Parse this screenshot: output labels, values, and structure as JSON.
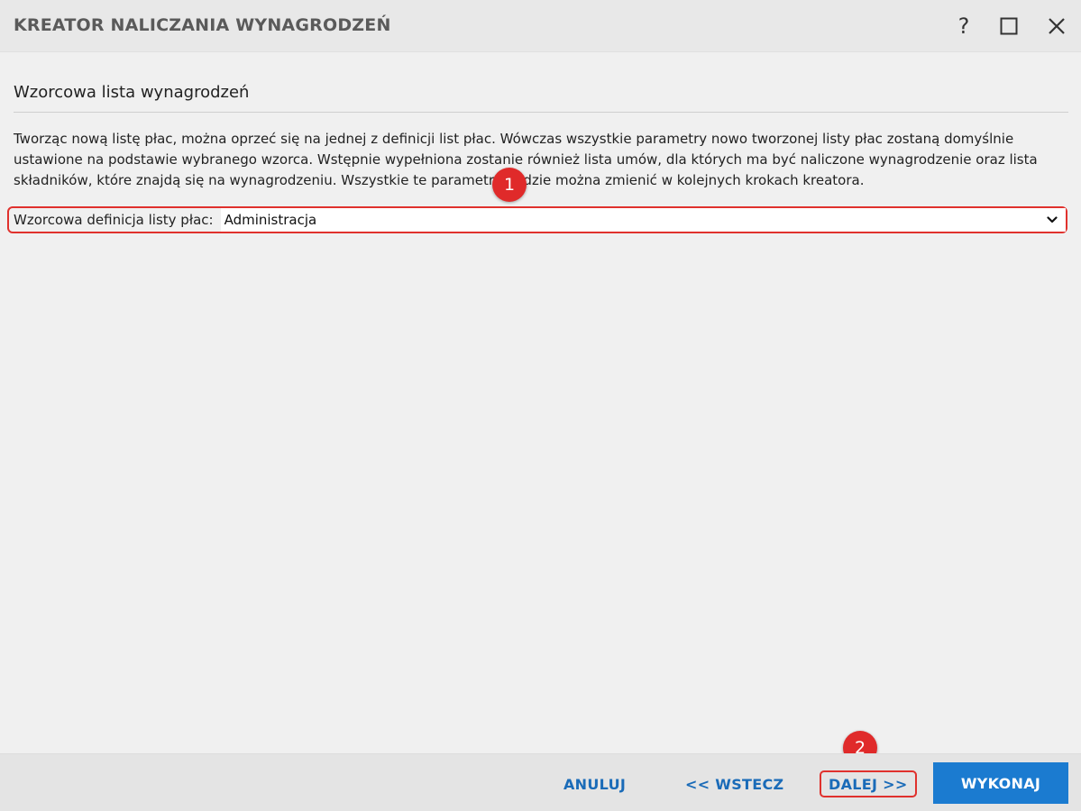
{
  "window": {
    "title": "KREATOR NALICZANIA WYNAGRODZEŃ",
    "help_label": "?"
  },
  "section": {
    "title": "Wzorcowa lista wynagrodzeń",
    "description": "Tworząc nową listę płac, można oprzeć się na jednej z definicji list płac. Wówczas wszystkie parametry nowo tworzonej listy płac zostaną domyślnie ustawione na podstawie wybranego wzorca. Wstępnie wypełniona zostanie również lista umów, dla których ma być naliczone wynagrodzenie oraz lista składników, które znajdą się na wynagrodzeniu. Wszystkie te parametry będzie można zmienić w kolejnych krokach kreatora."
  },
  "field": {
    "label": "Wzorcowa definicja listy płac:",
    "value": "Administracja"
  },
  "annotations": {
    "badge1": "1",
    "badge2": "2"
  },
  "footer": {
    "cancel": "ANULUJ",
    "back": "<< WSTECZ",
    "next": "DALEJ >>",
    "execute": "WYKONAJ"
  },
  "icons": {
    "maximize": "maximize-icon",
    "close": "close-icon",
    "dropdown": "chevron-down-icon"
  },
  "colors": {
    "accent": "#1b7bd0",
    "link": "#1a6bb8",
    "annotation": "#e0312d"
  }
}
